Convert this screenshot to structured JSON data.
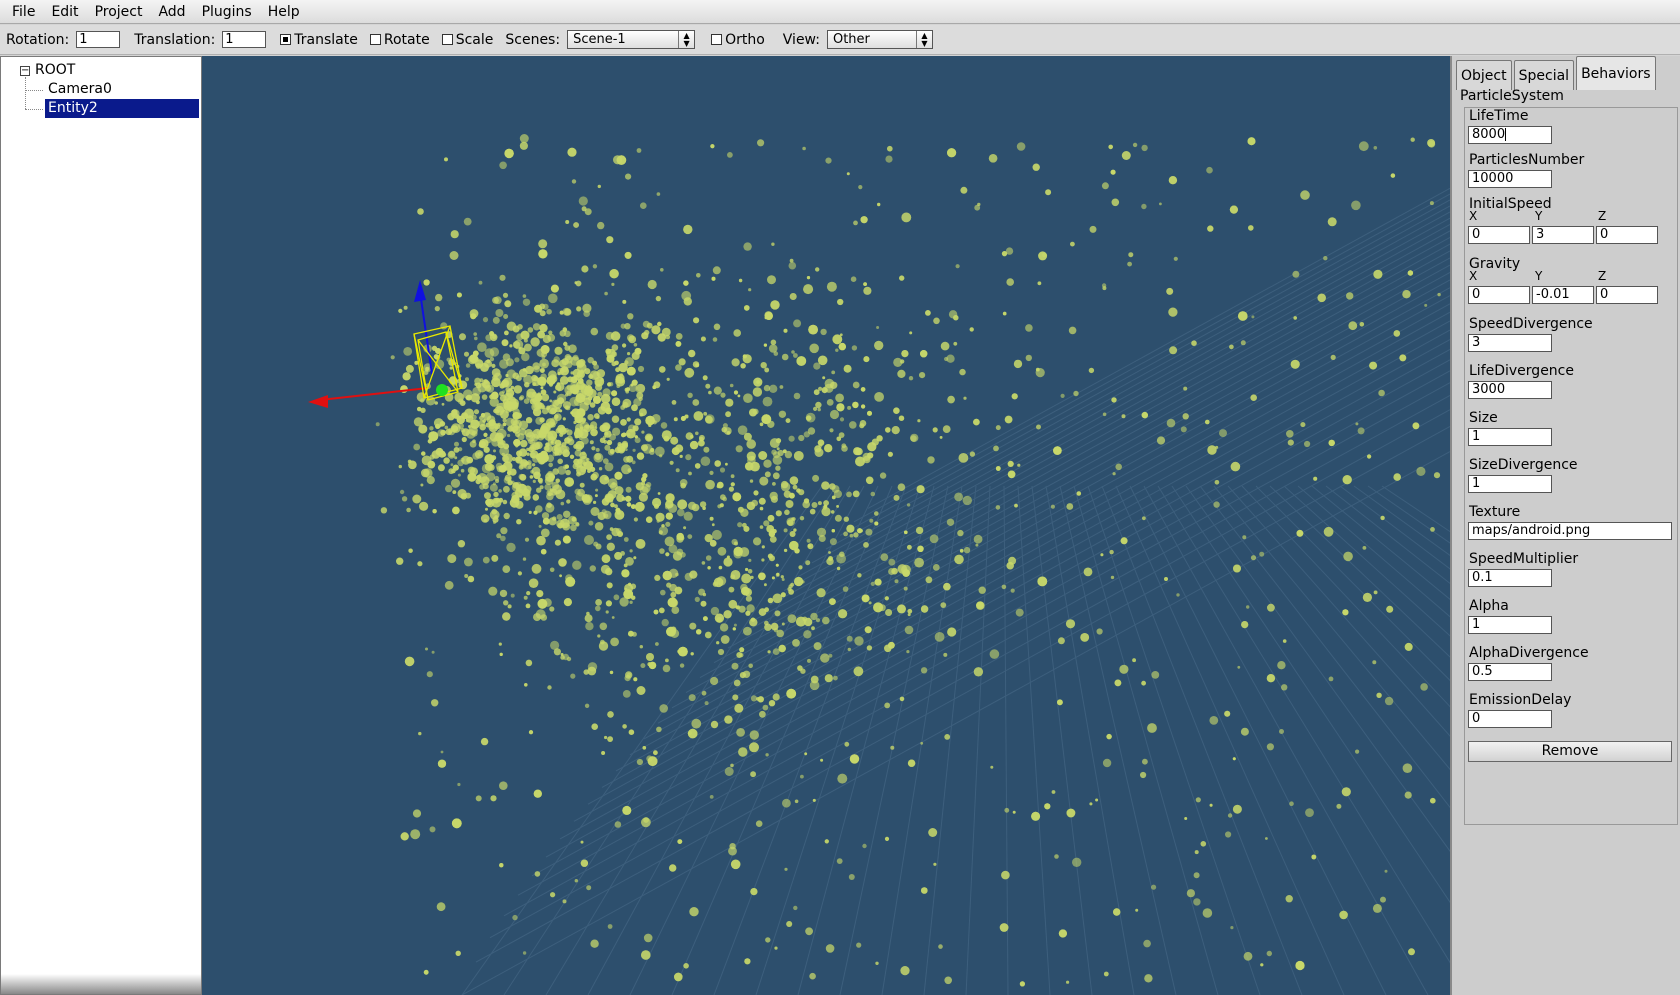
{
  "menu": [
    "File",
    "Edit",
    "Project",
    "Add",
    "Plugins",
    "Help"
  ],
  "toolbar": {
    "rotation_label": "Rotation:",
    "rotation_value": "1",
    "translation_label": "Translation:",
    "translation_value": "1",
    "translate_label": "Translate",
    "translate_checked": true,
    "rotate_label": "Rotate",
    "rotate_checked": false,
    "scale_label": "Scale",
    "scale_checked": false,
    "scenes_label": "Scenes:",
    "scenes_value": "Scene-1",
    "ortho_label": "Ortho",
    "ortho_checked": false,
    "view_label": "View:",
    "view_value": "Other"
  },
  "tree": {
    "root": "ROOT",
    "toggle": "−",
    "items": [
      "Camera0",
      "Entity2"
    ],
    "selected": "Entity2"
  },
  "colors": {
    "viewport_bg": "#2d4f6d",
    "particle": "#c8d86a",
    "axis_x": "#e01010",
    "axis_y": "#1010e0",
    "selection_box": "#e8e800",
    "pivot": "#20e020",
    "grid": "#3d5f7d"
  },
  "tabs": [
    "Object",
    "Special",
    "Behaviors"
  ],
  "active_tab": "Behaviors",
  "behavior": {
    "title": "ParticleSystem",
    "lifetime_label": "LifeTime",
    "lifetime": "8000",
    "particles_number_label": "ParticlesNumber",
    "particles_number": "10000",
    "initial_speed_label": "InitialSpeed",
    "initial_speed": {
      "x": "0",
      "y": "3",
      "z": "0"
    },
    "gravity_label": "Gravity",
    "gravity": {
      "x": "0",
      "y": "-0.01",
      "z": "0"
    },
    "axis_x_label": "X",
    "axis_y_label": "Y",
    "axis_z_label": "Z",
    "speed_divergence_label": "SpeedDivergence",
    "speed_divergence": "3",
    "life_divergence_label": "LifeDivergence",
    "life_divergence": "3000",
    "size_label": "Size",
    "size": "1",
    "size_divergence_label": "SizeDivergence",
    "size_divergence": "1",
    "texture_label": "Texture",
    "texture": "maps/android.png",
    "speed_multiplier_label": "SpeedMultiplier",
    "speed_multiplier": "0.1",
    "alpha_label": "Alpha",
    "alpha": "1",
    "alpha_divergence_label": "AlphaDivergence",
    "alpha_divergence": "0.5",
    "emission_delay_label": "EmissionDelay",
    "emission_delay": "0",
    "remove_label": "Remove"
  }
}
